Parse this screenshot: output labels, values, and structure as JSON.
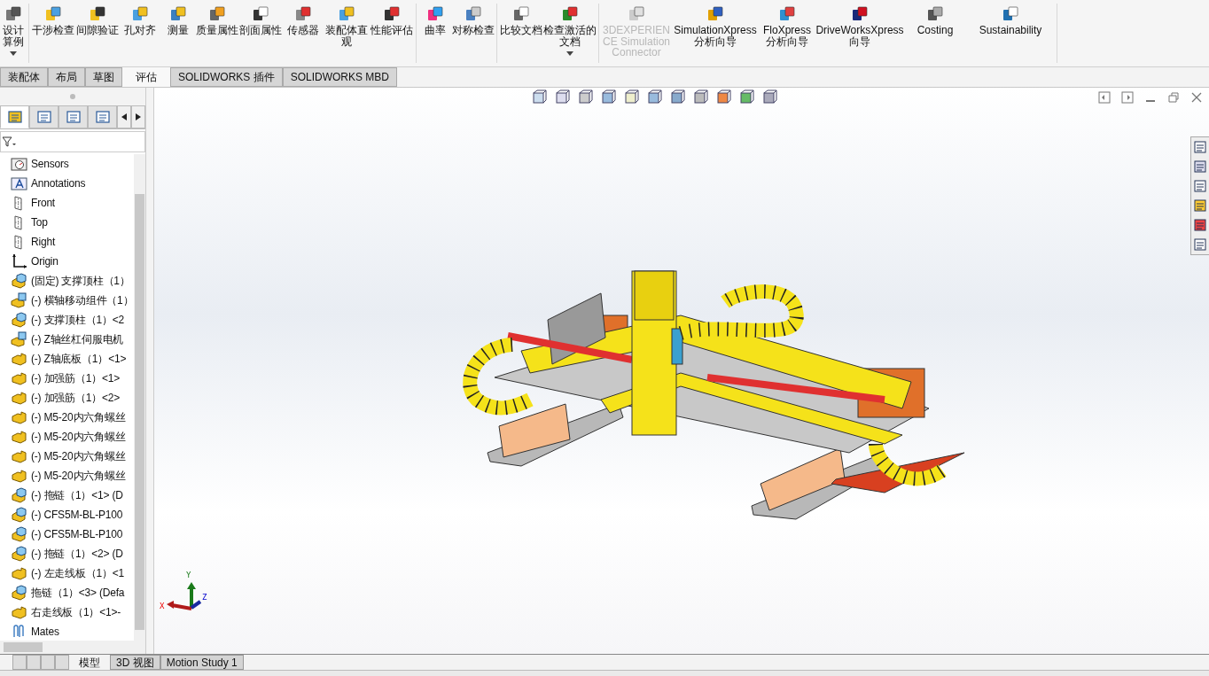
{
  "ribbon": {
    "groups": [
      {
        "buttons": [
          {
            "label": "设计算例",
            "dropdown": true,
            "disabled": false
          }
        ]
      },
      {
        "buttons": [
          {
            "label": "干涉检查",
            "dropdown": false,
            "disabled": false
          },
          {
            "label": "间隙验证",
            "dropdown": false,
            "disabled": false
          },
          {
            "label": "孔对齐",
            "dropdown": false,
            "disabled": false
          },
          {
            "label": "测量",
            "dropdown": false,
            "disabled": false
          },
          {
            "label": "质量属性",
            "dropdown": false,
            "disabled": false
          },
          {
            "label": "剖面属性",
            "dropdown": false,
            "disabled": false
          },
          {
            "label": "传感器",
            "dropdown": false,
            "disabled": false
          },
          {
            "label": "装配体直观",
            "dropdown": false,
            "disabled": false
          },
          {
            "label": "性能评估",
            "dropdown": false,
            "disabled": false
          }
        ]
      },
      {
        "buttons": [
          {
            "label": "曲率",
            "dropdown": false,
            "disabled": false
          },
          {
            "label": "对称检查",
            "dropdown": false,
            "disabled": false
          }
        ]
      },
      {
        "buttons": [
          {
            "label": "比较文档",
            "dropdown": false,
            "disabled": false
          },
          {
            "label": "检查激活的文档",
            "dropdown": true,
            "disabled": false
          }
        ]
      },
      {
        "buttons": [
          {
            "label": "3DEXPERIENCE Simulation Connector",
            "dropdown": false,
            "disabled": true
          },
          {
            "label": "SimulationXpress 分析向导",
            "dropdown": false,
            "disabled": false
          },
          {
            "label": "FloXpress 分析向导",
            "dropdown": false,
            "disabled": false
          },
          {
            "label": "DriveWorksXpress 向导",
            "dropdown": false,
            "disabled": false
          },
          {
            "label": "Costing",
            "dropdown": false,
            "disabled": false
          },
          {
            "label": "Sustainability",
            "dropdown": false,
            "disabled": false
          }
        ]
      }
    ]
  },
  "command_tabs": [
    {
      "label": "装配体",
      "selected": false
    },
    {
      "label": "布局",
      "selected": false
    },
    {
      "label": "草图",
      "selected": false
    },
    {
      "label": "评估",
      "selected": true
    },
    {
      "label": "SOLIDWORKS 插件",
      "selected": false
    },
    {
      "label": "SOLIDWORKS MBD",
      "selected": false
    }
  ],
  "panel_tabs": [
    {
      "selected": true
    },
    {
      "selected": false
    },
    {
      "selected": false
    },
    {
      "selected": false
    }
  ],
  "tree": [
    {
      "label": "Sensors",
      "kind": "sensors"
    },
    {
      "label": "Annotations",
      "kind": "annotations"
    },
    {
      "label": "Front",
      "kind": "plane"
    },
    {
      "label": "Top",
      "kind": "plane"
    },
    {
      "label": "Right",
      "kind": "plane"
    },
    {
      "label": "Origin",
      "kind": "origin"
    },
    {
      "label": "(固定) 支撑顶柱（1）",
      "kind": "component"
    },
    {
      "label": "(-) 横轴移动组件（1）",
      "kind": "subassembly"
    },
    {
      "label": "(-) 支撑顶柱（1）<2",
      "kind": "component"
    },
    {
      "label": "(-) Z轴丝杠伺服电机",
      "kind": "subassembly"
    },
    {
      "label": "(-) Z轴底板（1）<1>",
      "kind": "part"
    },
    {
      "label": "(-) 加强筋（1）<1>",
      "kind": "part"
    },
    {
      "label": "(-) 加强筋（1）<2>",
      "kind": "part"
    },
    {
      "label": "(-) M5-20内六角螺丝",
      "kind": "part"
    },
    {
      "label": "(-) M5-20内六角螺丝",
      "kind": "part"
    },
    {
      "label": "(-) M5-20内六角螺丝",
      "kind": "part"
    },
    {
      "label": "(-) M5-20内六角螺丝",
      "kind": "part"
    },
    {
      "label": "(-) 拖链（1）<1> (D",
      "kind": "component"
    },
    {
      "label": "(-) CFS5M-BL-P100",
      "kind": "component"
    },
    {
      "label": "(-) CFS5M-BL-P100",
      "kind": "component"
    },
    {
      "label": "(-) 拖链（1）<2> (D",
      "kind": "component"
    },
    {
      "label": "(-) 左走线板（1）<1",
      "kind": "part"
    },
    {
      "label": "拖链（1）<3> (Defa",
      "kind": "component"
    },
    {
      "label": "右走线板（1）<1>-",
      "kind": "part"
    },
    {
      "label": "Mates",
      "kind": "mates"
    }
  ],
  "triad": {
    "x": "X",
    "y": "Y",
    "z": "Z"
  },
  "bottom_tabs": [
    {
      "label": "模型",
      "selected": true
    },
    {
      "label": "3D 视图",
      "selected": false
    },
    {
      "label": "Motion Study 1",
      "selected": false
    }
  ]
}
